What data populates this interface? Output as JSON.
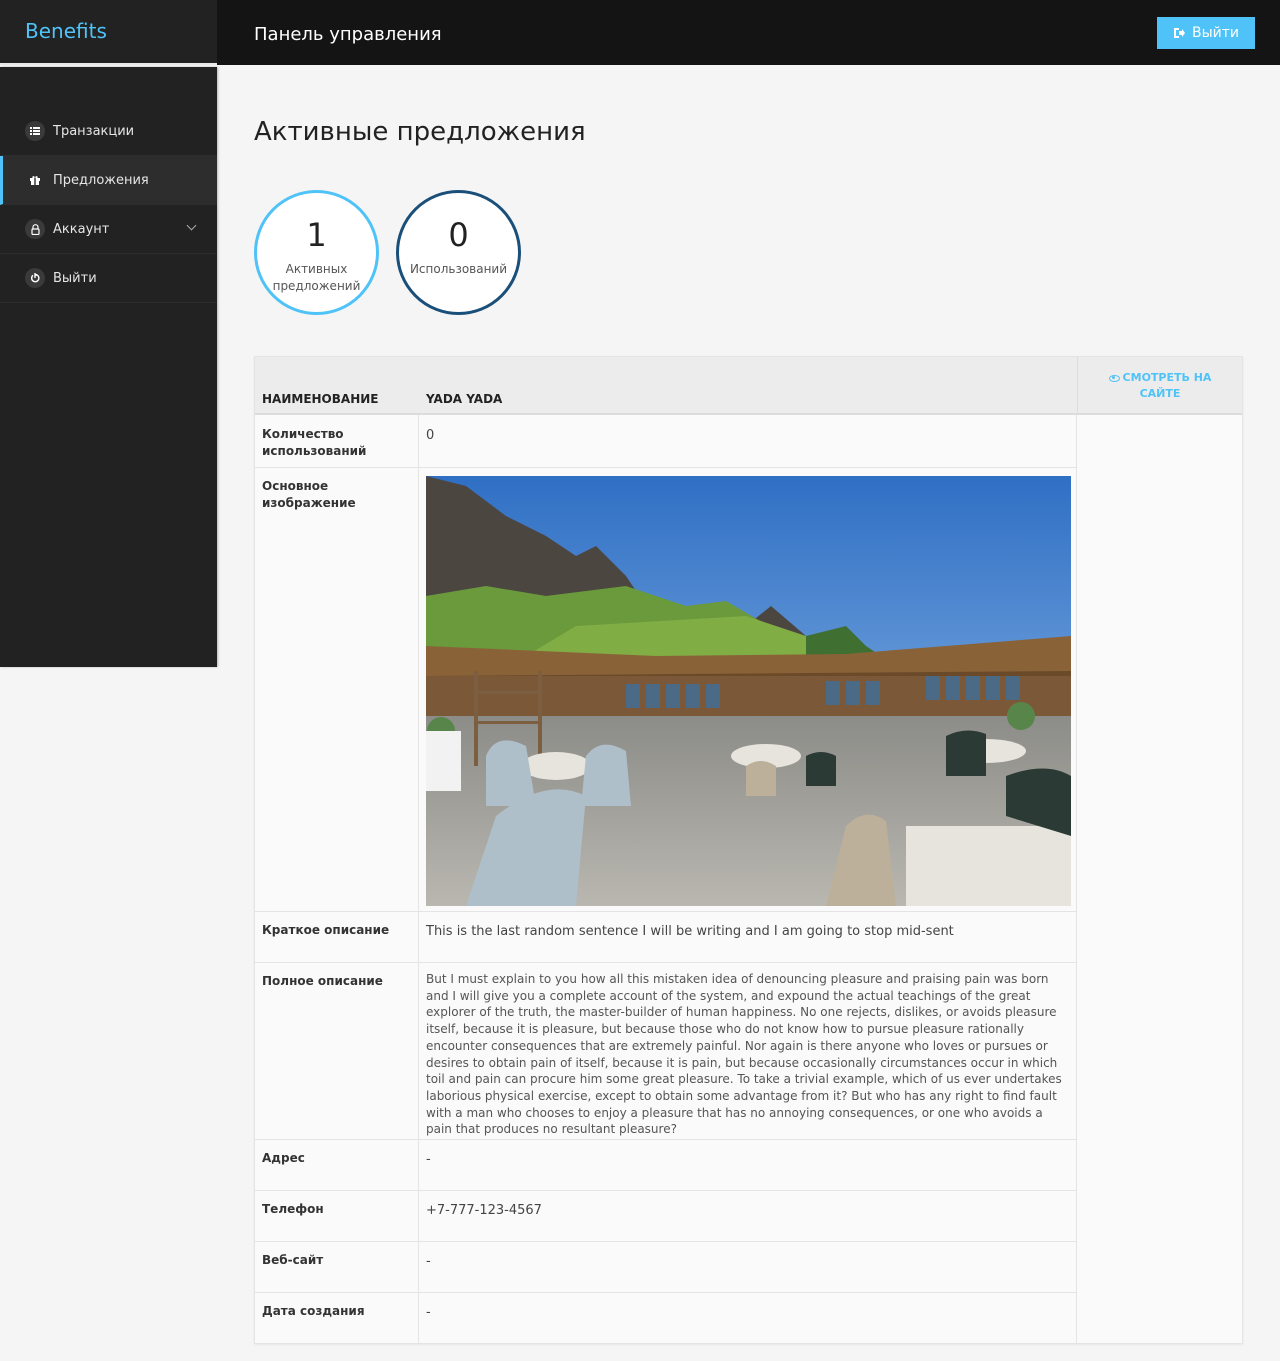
{
  "brand": "Benefits",
  "header": {
    "title": "Панель управления",
    "logout_label": "Выйти"
  },
  "sidebar": {
    "items": [
      {
        "label": "Транзакции",
        "icon": "list-icon"
      },
      {
        "label": "Предложения",
        "icon": "gift-icon",
        "active": true
      },
      {
        "label": "Аккаунт",
        "icon": "lock-icon",
        "has_submenu": true
      },
      {
        "label": "Выйти",
        "icon": "power-icon"
      }
    ]
  },
  "main": {
    "title": "Активные предложения",
    "stats": [
      {
        "value": "1",
        "label_line1": "Активных",
        "label_line2": "предложений",
        "color": "#4fc3f7"
      },
      {
        "value": "0",
        "label_line1": "Использований",
        "label_line2": "",
        "color": "#1a4f7a"
      }
    ],
    "table": {
      "header_label": "НАИМЕНОВАНИЕ",
      "header_value": "YADA YADA",
      "view_link_line1": "СМОТРЕТЬ НА",
      "view_link_line2": "САЙТЕ",
      "rows": {
        "uses": {
          "label_line1": "Количество",
          "label_line2": "использований",
          "value": "0"
        },
        "image": {
          "label": "Основное изображение",
          "alt": "mountain-terrace-photo"
        },
        "short": {
          "label": "Краткое описание",
          "value": "This is the last random sentence I will be writing and I am going to stop mid-sent"
        },
        "full": {
          "label": "Полное описание",
          "value": "But I must explain to you how all this mistaken idea of denouncing pleasure and praising pain was born and I will give you a complete account of the system, and expound the actual teachings of the great explorer of the truth, the master-builder of human happiness. No one rejects, dislikes, or avoids pleasure itself, because it is pleasure, but because those who do not know how to pursue pleasure rationally encounter consequences that are extremely painful. Nor again is there anyone who loves or pursues or desires to obtain pain of itself, because it is pain, but because occasionally circumstances occur in which toil and pain can procure him some great pleasure. To take a trivial example, which of us ever undertakes laborious physical exercise, except to obtain some advantage from it? But who has any right to find fault with a man who chooses to enjoy a pleasure that has no annoying consequences, or one who avoids a pain that produces no resultant pleasure?"
        },
        "address": {
          "label": "Адрес",
          "value": "-"
        },
        "phone": {
          "label": "Телефон",
          "value": "+7-777-123-4567"
        },
        "website": {
          "label": "Веб-сайт",
          "value": "-"
        },
        "created": {
          "label": "Дата создания",
          "value": "-"
        }
      }
    }
  },
  "colors": {
    "accent": "#4fc3f7",
    "dark": "#222222",
    "topbar": "#141414",
    "navy": "#1a4f7a"
  }
}
